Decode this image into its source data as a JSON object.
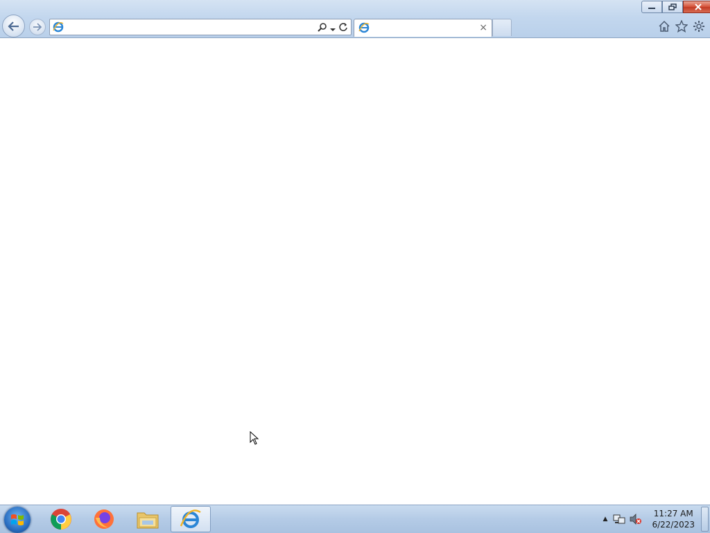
{
  "browser": {
    "address_bar": {
      "value": "",
      "placeholder": ""
    },
    "tab": {
      "title": "",
      "close_glyph": "×"
    },
    "window_controls": [
      "minimize-icon",
      "restore-icon",
      "close-icon"
    ],
    "toolbar_icons": [
      "home-icon",
      "star-icon",
      "gear-icon"
    ]
  },
  "taskbar": {
    "apps": [
      {
        "name": "chrome",
        "icon": "chrome-icon"
      },
      {
        "name": "firefox",
        "icon": "firefox-icon"
      },
      {
        "name": "file-explorer",
        "icon": "folder-icon"
      },
      {
        "name": "internet-explorer",
        "icon": "ie-icon",
        "active": true
      }
    ],
    "tray": {
      "chevron": "▲",
      "time": "11:27 AM",
      "date": "6/22/2023"
    }
  },
  "colors": {
    "chrome_frame": "#c3d7ee",
    "close_button": "#c94a33",
    "taskbar": "#b4cbe6"
  }
}
